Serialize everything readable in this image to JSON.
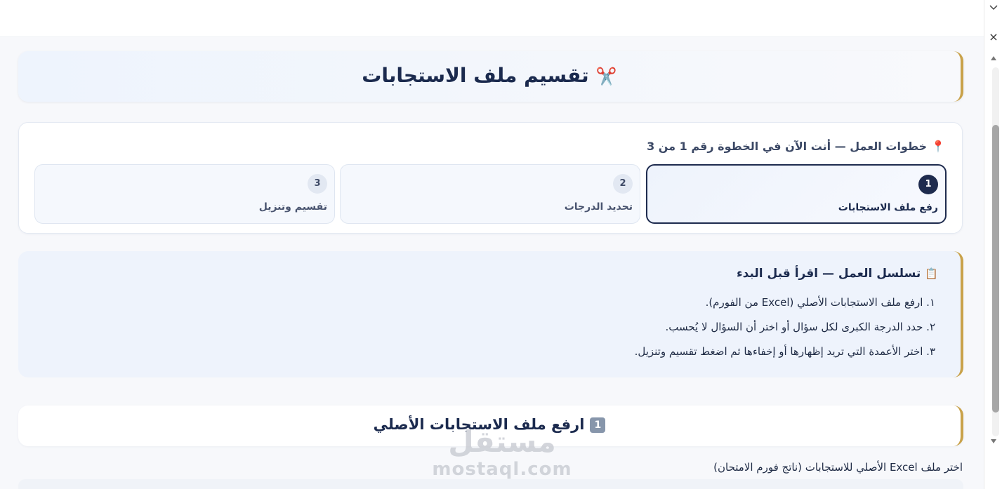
{
  "hero": {
    "icon": "✂️",
    "title": "تقسيم ملف الاستجابات"
  },
  "steps": {
    "pin_icon": "📍",
    "header": "خطوات العمل — أنت الآن في الخطوة رقم 1 من 3",
    "items": [
      {
        "num": "1",
        "label": "رفع ملف الاستجابات",
        "active": true
      },
      {
        "num": "2",
        "label": "تحديد الدرجات",
        "active": false
      },
      {
        "num": "3",
        "label": "تقسيم وتنزيل",
        "active": false
      }
    ]
  },
  "flow": {
    "icon": "📋",
    "title": "تسلسل العمل — اقرأ قبل البدء",
    "items": [
      "١. ارفع ملف الاستجابات الأصلي (Excel من الفورم).",
      "٢. حدد الدرجة الكبرى لكل سؤال أو اختر أن السؤال لا يُحسب.",
      "٣. اختر الأعمدة التي تريد إظهارها أو إخفاءها ثم اضغط تقسيم وتنزيل."
    ]
  },
  "upload": {
    "badge": "1",
    "title": "ارفع ملف الاستجابات الأصلي",
    "hint": "اختر ملف Excel الأصلي للاستجابات (ناتج فورم الامتحان)"
  },
  "watermark": {
    "arabic": "مستقل",
    "latin": "mostaql.com"
  },
  "scrollbar": {
    "close_glyph": "×"
  },
  "colors": {
    "accent": "#c9a24a",
    "navy": "#1e2b4e",
    "panel": "#eef3fc"
  }
}
